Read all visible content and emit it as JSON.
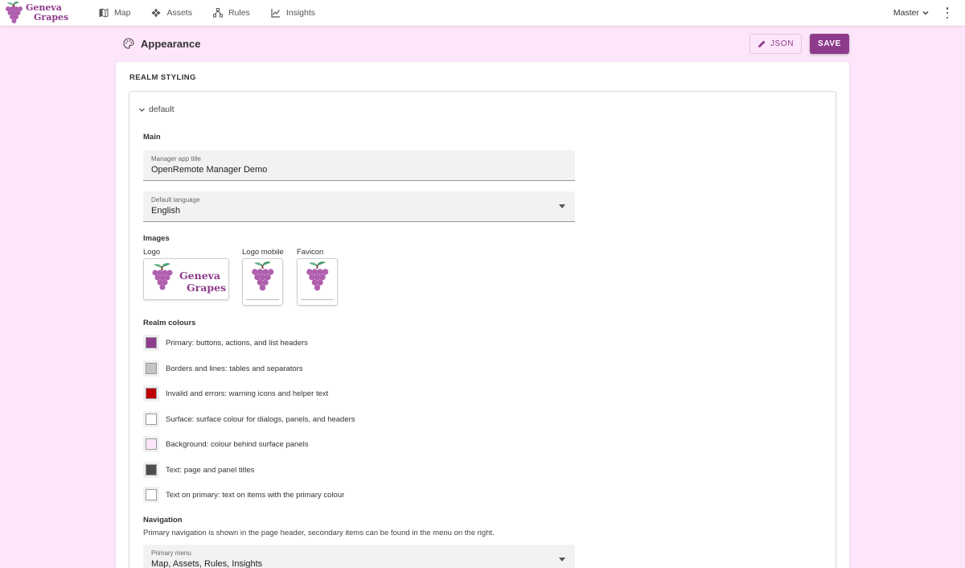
{
  "header": {
    "brand_line1": "Geneva",
    "brand_line2": "Grapes",
    "nav": [
      {
        "label": "Map",
        "icon": "map-icon"
      },
      {
        "label": "Assets",
        "icon": "assets-icon"
      },
      {
        "label": "Rules",
        "icon": "rules-icon"
      },
      {
        "label": "Insights",
        "icon": "insights-icon"
      }
    ],
    "realm": "Master"
  },
  "page": {
    "title": "Appearance",
    "json_label": "JSON",
    "save_label": "SAVE"
  },
  "card": {
    "title": "REALM STYLING",
    "panel_title": "default",
    "main_label": "Main",
    "app_title": {
      "label": "Manager app title",
      "value": "OpenRemote Manager Demo"
    },
    "language": {
      "label": "Default language",
      "value": "English"
    },
    "images_label": "Images",
    "logo_label": "Logo",
    "logo_mobile_label": "Logo mobile",
    "favicon_label": "Favicon",
    "colours_label": "Realm colours",
    "colours": [
      {
        "label": "Primary: buttons, actions, and list headers",
        "color": "#8e3b8c"
      },
      {
        "label": "Borders and lines: tables and separators",
        "color": "#c4c4c4"
      },
      {
        "label": "Invalid and errors: warning icons and helper text",
        "color": "#c00000"
      },
      {
        "label": "Surface: surface colour for dialogs, panels, and headers",
        "color": "#ffffff"
      },
      {
        "label": "Background: colour behind surface panels",
        "color": "#fde6fb"
      },
      {
        "label": "Text: page and panel titles",
        "color": "#4d4d4d"
      },
      {
        "label": "Text on primary: text on items with the primary colour",
        "color": "#ffffff"
      }
    ],
    "navigation_label": "Navigation",
    "navigation_desc": "Primary navigation is shown in the page header, secondary items can be found in the menu on the right.",
    "primary_menu": {
      "label": "Primary menu",
      "value": "Map, Assets, Rules, Insights"
    }
  },
  "colors": {
    "primary": "#8e3b8c",
    "background": "#fde6fb"
  }
}
